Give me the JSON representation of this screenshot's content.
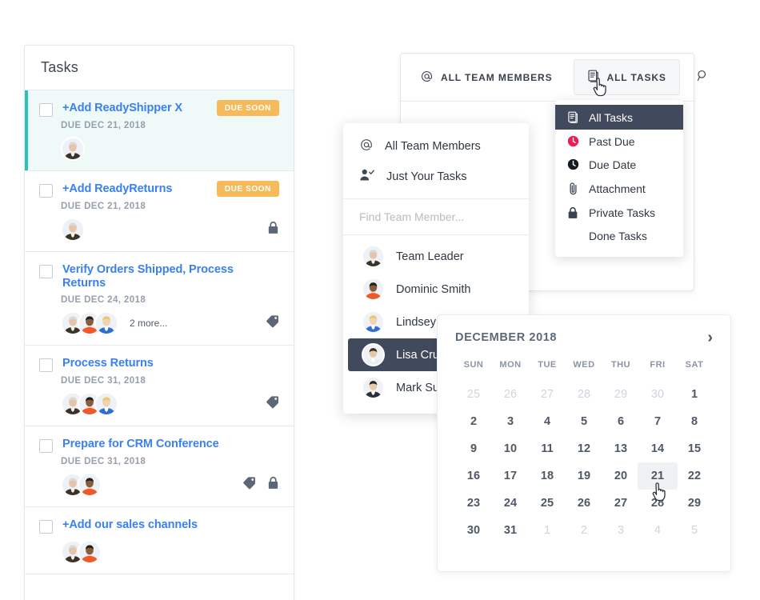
{
  "tasks_panel": {
    "title": "Tasks",
    "rows": [
      {
        "title": "+Add ReadyShipper X",
        "due": "DUE DEC 21, 2018",
        "badge": "DUE SOON",
        "avatars": 1,
        "tag": false,
        "lock": false,
        "more": "",
        "selected": true
      },
      {
        "title": "+Add ReadyReturns",
        "due": "DUE DEC 21, 2018",
        "badge": "DUE SOON",
        "avatars": 1,
        "tag": false,
        "lock": true,
        "more": "",
        "selected": false
      },
      {
        "title": "Verify Orders Shipped, Process Returns",
        "due": "DUE DEC 24, 2018",
        "badge": "",
        "avatars": 3,
        "tag": true,
        "lock": false,
        "more": "2 more...",
        "selected": false
      },
      {
        "title": "Process Returns",
        "due": "DUE DEC 31, 2018",
        "badge": "",
        "avatars": 3,
        "tag": true,
        "lock": false,
        "more": "",
        "selected": false
      },
      {
        "title": "Prepare for CRM Conference",
        "due": "DUE DEC 31, 2018",
        "badge": "",
        "avatars": 2,
        "tag": true,
        "lock": true,
        "more": "",
        "selected": false
      },
      {
        "title": "+Add our sales channels",
        "due": "",
        "badge": "",
        "avatars": 2,
        "tag": false,
        "lock": false,
        "more": "",
        "selected": false
      }
    ]
  },
  "filter_bar": {
    "members_filter_label": "ALL TEAM MEMBERS",
    "members_filter_icon": "at-icon",
    "tasks_filter_label": "ALL TASKS",
    "tasks_filter_icon": "clipboard-icon",
    "search_icon": "search-icon"
  },
  "tasks_dropdown": {
    "items": [
      {
        "label": "All Tasks",
        "icon": "clipboard-icon",
        "active": true
      },
      {
        "label": "Past Due",
        "icon": "clock-red-icon",
        "active": false
      },
      {
        "label": "Due Date",
        "icon": "clock-dark-icon",
        "active": false
      },
      {
        "label": "Attachment",
        "icon": "paperclip-icon",
        "active": false
      },
      {
        "label": "Private Tasks",
        "icon": "lock-icon",
        "active": false
      },
      {
        "label": "Done Tasks",
        "icon": "",
        "active": false
      }
    ]
  },
  "members_dropdown": {
    "options": [
      {
        "label": "All Team Members",
        "icon": "at-icon"
      },
      {
        "label": "Just Your Tasks",
        "icon": "user-check-icon"
      }
    ],
    "search_placeholder": "Find Team Member...",
    "members": [
      {
        "name": "Team Leader",
        "active": false
      },
      {
        "name": "Dominic Smith",
        "active": false
      },
      {
        "name": "Lindsey Robbins",
        "active": false
      },
      {
        "name": "Lisa Cruz",
        "active": true
      },
      {
        "name": "Mark Sumo",
        "active": false
      }
    ],
    "remove_label": "×"
  },
  "calendar": {
    "month_label": "DECEMBER 2018",
    "next_label": "›",
    "day_names": [
      "SUN",
      "MON",
      "TUE",
      "WED",
      "THU",
      "FRI",
      "SAT"
    ],
    "weeks": [
      [
        {
          "d": "25",
          "muted": true
        },
        {
          "d": "26",
          "muted": true
        },
        {
          "d": "27",
          "muted": true
        },
        {
          "d": "28",
          "muted": true
        },
        {
          "d": "29",
          "muted": true
        },
        {
          "d": "30",
          "muted": true
        },
        {
          "d": "1",
          "muted": false
        }
      ],
      [
        {
          "d": "2",
          "muted": false
        },
        {
          "d": "3",
          "muted": false
        },
        {
          "d": "4",
          "muted": false
        },
        {
          "d": "5",
          "muted": false
        },
        {
          "d": "6",
          "muted": false
        },
        {
          "d": "7",
          "muted": false
        },
        {
          "d": "8",
          "muted": false
        }
      ],
      [
        {
          "d": "9",
          "muted": false
        },
        {
          "d": "10",
          "muted": false
        },
        {
          "d": "11",
          "muted": false
        },
        {
          "d": "12",
          "muted": false
        },
        {
          "d": "13",
          "muted": false
        },
        {
          "d": "14",
          "muted": false
        },
        {
          "d": "15",
          "muted": false
        }
      ],
      [
        {
          "d": "16",
          "muted": false
        },
        {
          "d": "17",
          "muted": false
        },
        {
          "d": "18",
          "muted": false
        },
        {
          "d": "19",
          "muted": false
        },
        {
          "d": "20",
          "muted": false
        },
        {
          "d": "21",
          "muted": false,
          "today": true
        },
        {
          "d": "22",
          "muted": false
        }
      ],
      [
        {
          "d": "23",
          "muted": false
        },
        {
          "d": "24",
          "muted": false
        },
        {
          "d": "25",
          "muted": false
        },
        {
          "d": "26",
          "muted": false
        },
        {
          "d": "27",
          "muted": false
        },
        {
          "d": "28",
          "muted": false
        },
        {
          "d": "29",
          "muted": false
        }
      ],
      [
        {
          "d": "30",
          "muted": false
        },
        {
          "d": "31",
          "muted": false
        },
        {
          "d": "1",
          "muted": true
        },
        {
          "d": "2",
          "muted": true
        },
        {
          "d": "3",
          "muted": true
        },
        {
          "d": "4",
          "muted": true
        },
        {
          "d": "5",
          "muted": true
        }
      ]
    ]
  },
  "colors": {
    "accent_teal": "#2bc4b4",
    "link_blue": "#3a80f0",
    "badge_orange": "#f8b958",
    "dark_menu": "#414a5c",
    "past_due_red": "#ef1e51",
    "muted_gray": "#96a0ad"
  }
}
